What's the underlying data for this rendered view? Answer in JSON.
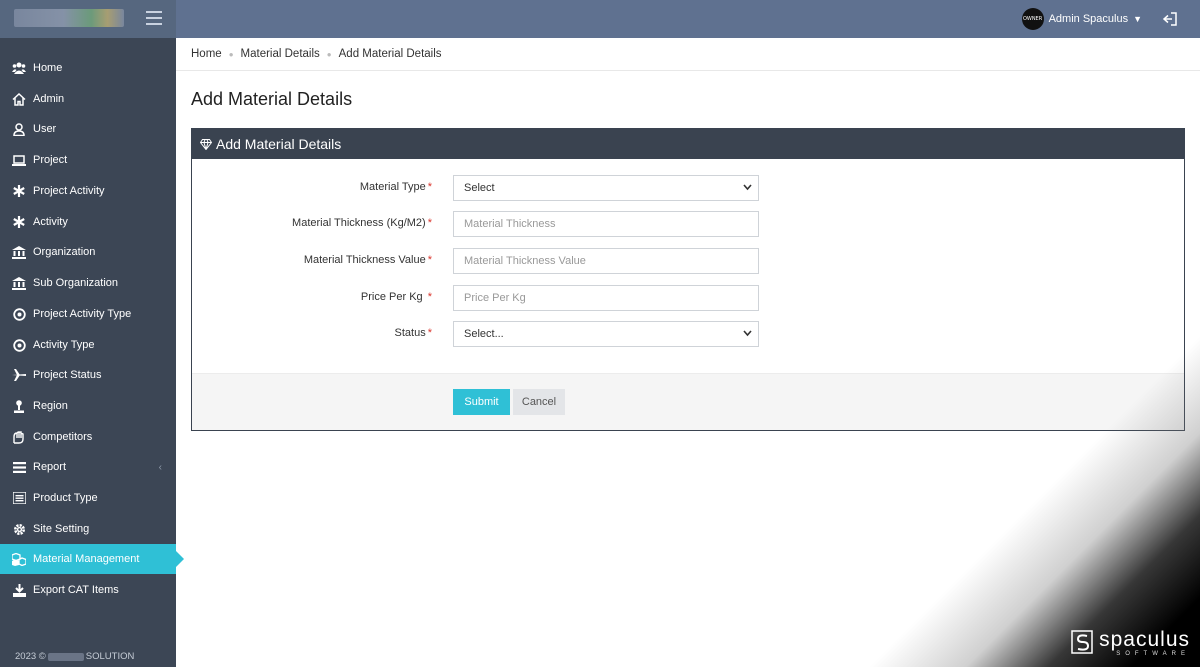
{
  "header": {
    "avatar_text": "OWNER",
    "user_name": "Admin Spaculus"
  },
  "sidebar": {
    "items": [
      {
        "label": "Home",
        "icon": "users-icon"
      },
      {
        "label": "Admin",
        "icon": "home-icon"
      },
      {
        "label": "User",
        "icon": "user-icon"
      },
      {
        "label": "Project",
        "icon": "laptop-icon"
      },
      {
        "label": "Project Activity",
        "icon": "asterisk-icon"
      },
      {
        "label": "Activity",
        "icon": "asterisk-icon"
      },
      {
        "label": "Organization",
        "icon": "bank-icon"
      },
      {
        "label": "Sub Organization",
        "icon": "bank-icon"
      },
      {
        "label": "Project Activity Type",
        "icon": "target-icon"
      },
      {
        "label": "Activity Type",
        "icon": "target-icon"
      },
      {
        "label": "Project Status",
        "icon": "plane-icon"
      },
      {
        "label": "Region",
        "icon": "pin-icon"
      },
      {
        "label": "Competitors",
        "icon": "handshake-icon"
      },
      {
        "label": "Report",
        "icon": "list-icon"
      },
      {
        "label": "Product Type",
        "icon": "product-list-icon"
      },
      {
        "label": "Site Setting",
        "icon": "gear-icon"
      },
      {
        "label": "Material Management",
        "icon": "cubes-icon"
      },
      {
        "label": "Export CAT Items",
        "icon": "download-icon"
      }
    ],
    "active_index": 16,
    "footer_year": "2023 ©",
    "footer_company": "SOLUTION"
  },
  "breadcrumb": [
    "Home",
    "Material Details",
    "Add Material Details"
  ],
  "page_title": "Add Material Details",
  "card": {
    "title": "Add Material Details",
    "fields": [
      {
        "label": "Material Type",
        "type": "select",
        "value": "Select"
      },
      {
        "label": "Material Thickness (Kg/M2)",
        "type": "input",
        "placeholder": "Material Thickness"
      },
      {
        "label": "Material Thickness Value",
        "type": "input",
        "placeholder": "Material Thickness Value"
      },
      {
        "label": "Price Per Kg ",
        "type": "input",
        "placeholder": "Price Per Kg"
      },
      {
        "label": "Status",
        "type": "select",
        "value": "Select..."
      }
    ],
    "submit_label": "Submit",
    "cancel_label": "Cancel"
  },
  "watermark": {
    "brand": "spaculus",
    "sub": "SOFTWARE"
  },
  "colors": {
    "topbar": "#5f7190",
    "sidebar": "#3c4655",
    "accent": "#2fc0d6",
    "card_header": "#3a4350",
    "required": "#d9342c"
  }
}
